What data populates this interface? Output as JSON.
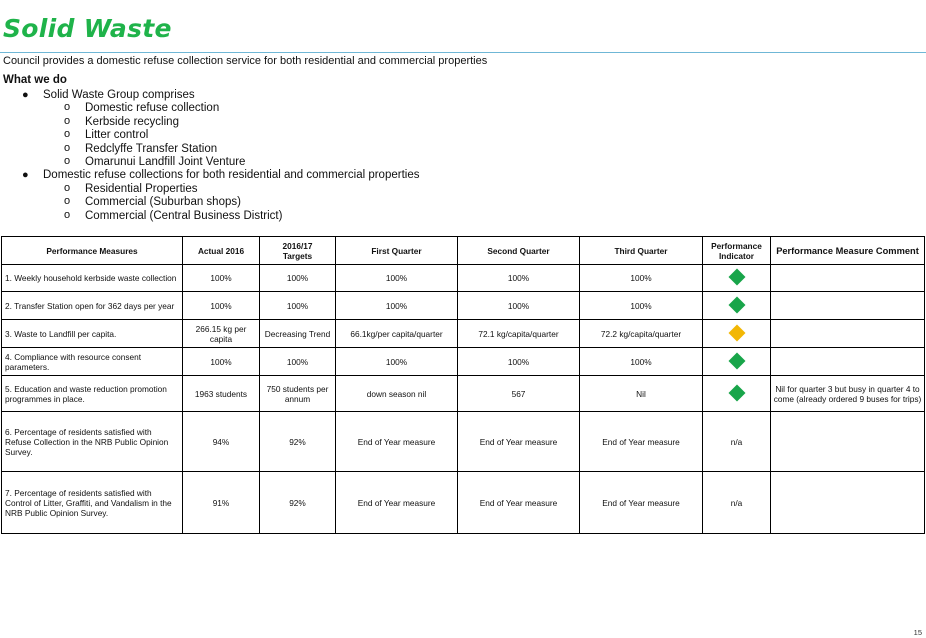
{
  "page": {
    "title": "Solid Waste",
    "intro": "Council provides a domestic refuse collection service for both residential and commercial properties",
    "what_we_do_heading": "What we do",
    "page_number": "15"
  },
  "outline": [
    {
      "text": "Solid Waste Group comprises",
      "children": [
        "Domestic refuse collection",
        "Kerbside recycling",
        "Litter control",
        "Redclyffe Transfer Station",
        "Omarunui Landfill Joint Venture"
      ]
    },
    {
      "text": "Domestic refuse collections for both residential and commercial properties",
      "children": [
        "Residential Properties",
        "Commercial (Suburban shops)",
        "Commercial (Central Business District)"
      ]
    }
  ],
  "table": {
    "headers": {
      "measure": "Performance Measures",
      "actual": "Actual 2016",
      "targets_line1": "2016/17",
      "targets_line2": "Targets",
      "q1": "First Quarter",
      "q2": "Second Quarter",
      "q3": "Third Quarter",
      "indicator": "Performance Indicator",
      "comment": "Performance Measure Comment"
    },
    "rows": [
      {
        "measure": "1.   Weekly household kerbside waste collection",
        "actual": "100%",
        "target": "100%",
        "q1": "100%",
        "q2": "100%",
        "q3": "100%",
        "indicator": "green",
        "comment": ""
      },
      {
        "measure": "2. Transfer Station open for 362 days per year",
        "actual": "100%",
        "target": "100%",
        "q1": "100%",
        "q2": "100%",
        "q3": "100%",
        "indicator": "green",
        "comment": ""
      },
      {
        "measure": "3. Waste to Landfill per capita.",
        "actual": "266.15 kg per capita",
        "target": "Decreasing Trend",
        "q1": "66.1kg/per capita/quarter",
        "q2": "72.1 kg/capita/quarter",
        "q3": "72.2 kg/capita/quarter",
        "indicator": "amber",
        "comment": ""
      },
      {
        "measure": "4. Compliance with resource consent parameters.",
        "actual": "100%",
        "target": "100%",
        "q1": "100%",
        "q2": "100%",
        "q3": "100%",
        "indicator": "green",
        "comment": ""
      },
      {
        "measure": "5.  Education and waste reduction promotion programmes in place.",
        "actual": "1963 students",
        "target": "750 students per annum",
        "q1": "down season nil",
        "q2": "567",
        "q3": "Nil",
        "indicator": "green",
        "comment": "Nil for quarter 3 but busy in quarter 4 to come (already ordered 9 buses for trips)"
      },
      {
        "measure": "6. Percentage of residents satisfied with Refuse Collection in the NRB Public Opinion Survey.",
        "actual": "94%",
        "target": "92%",
        "q1": "End of Year measure",
        "q2": "End of Year measure",
        "q3": "End of Year measure",
        "indicator": "n/a",
        "comment": ""
      },
      {
        "measure": "7.  Percentage of residents satisfied with Control of Litter, Graffiti, and Vandalism in the NRB Public Opinion Survey.",
        "actual": "91%",
        "target": "92%",
        "q1": "End of Year measure",
        "q2": "End of Year measure",
        "q3": "End of Year measure",
        "indicator": "n/a",
        "comment": ""
      }
    ]
  },
  "colors": {
    "title": "#1fb34a",
    "indicator_green": "#18a54a",
    "indicator_amber": "#f2b705"
  }
}
